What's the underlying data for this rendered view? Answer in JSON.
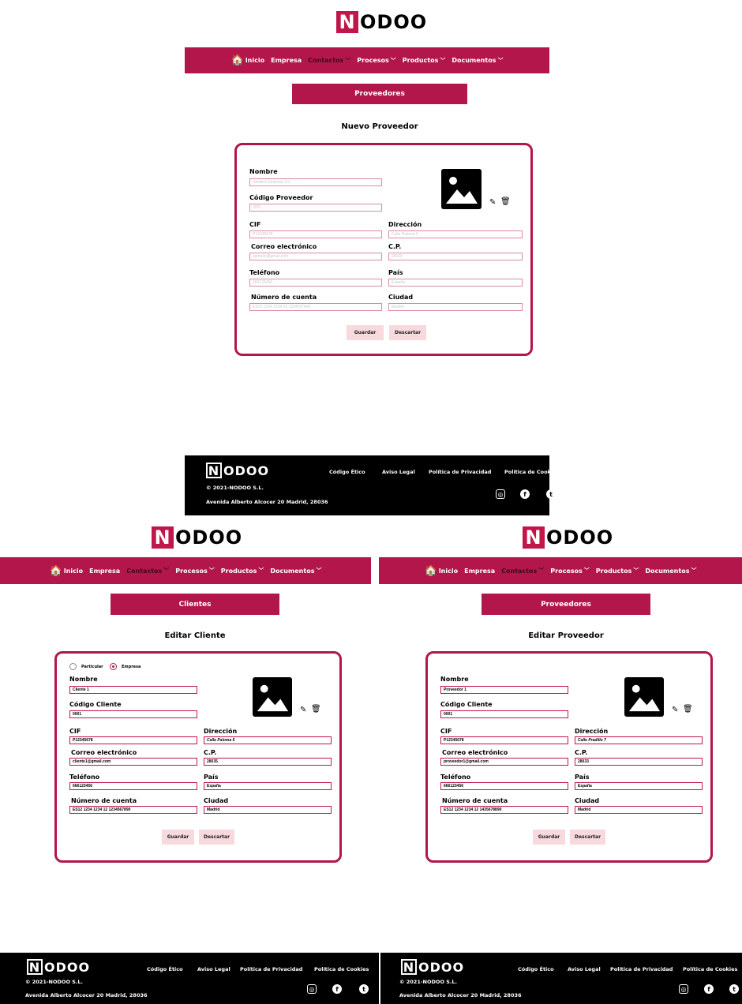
{
  "brand": {
    "n": "N",
    "rest": "ODOO",
    "accent": "#b3164a"
  },
  "nav": {
    "home": "Inicio",
    "empresa": "Empresa",
    "contactos": "Contactos",
    "procesos": "Procesos",
    "productos": "Productos",
    "documentos": "Documentos"
  },
  "labels": {
    "nombre": "Nombre",
    "codigo_proveedor": "Código Proveedor",
    "codigo_cliente": "Código Cliente",
    "cif": "CIF",
    "direccion": "Dirección",
    "correo": "Correo electrónico",
    "cp": "C.P.",
    "telefono": "Teléfono",
    "pais": "País",
    "cuenta": "Número de cuenta",
    "ciudad": "Ciudad",
    "guardar": "Guardar",
    "descartar": "Descartar",
    "particular": "Particular",
    "empresa": "Empresa"
  },
  "screen1": {
    "section": "Proveedores",
    "title": "Nuevo Proveedor",
    "placeholders": {
      "nombre": "Nombre Empresa S.L.",
      "codigo": "0001",
      "cif": "P12345678",
      "direccion": "Calle Paloma 5",
      "correo": "ejemplo@gmail.com",
      "cp": "28035",
      "telefono": "666123456",
      "pais": "España",
      "cuenta": "ES12 1234 1234 12 1234567890",
      "ciudad": "Madrid"
    }
  },
  "screen2": {
    "section": "Clientes",
    "title": "Editar Cliente",
    "values": {
      "nombre": "Cliente 1",
      "codigo": "0001",
      "cif": "P12345678",
      "direccion": "Calle Paloma 5",
      "correo": "cliente1@gmail.com",
      "cp": "28035",
      "telefono": "666123456",
      "pais": "España",
      "cuenta": "ES12 1234 1234 12 1234567890",
      "ciudad": "Madrid"
    }
  },
  "screen3": {
    "section": "Proveedores",
    "title": "Editar Proveedor",
    "values": {
      "nombre": "Proveedor 1",
      "codigo": "0001",
      "cif": "P12345678",
      "direccion": "Calle Pradillo 7",
      "correo": "proveedor1@gmail.com",
      "cp": "28033",
      "telefono": "666123456",
      "pais": "España",
      "cuenta": "ES12 1234 1234 12 1435678890",
      "ciudad": "Madrid"
    }
  },
  "footer": {
    "copyright": "© 2021-NODOO S.L.",
    "address": "Avenida Alberto Alcocer 20 Madrid, 28036",
    "links": [
      "Código Ético",
      "Aviso Legal",
      "Política de Privacidad",
      "Política de Cookies"
    ]
  }
}
